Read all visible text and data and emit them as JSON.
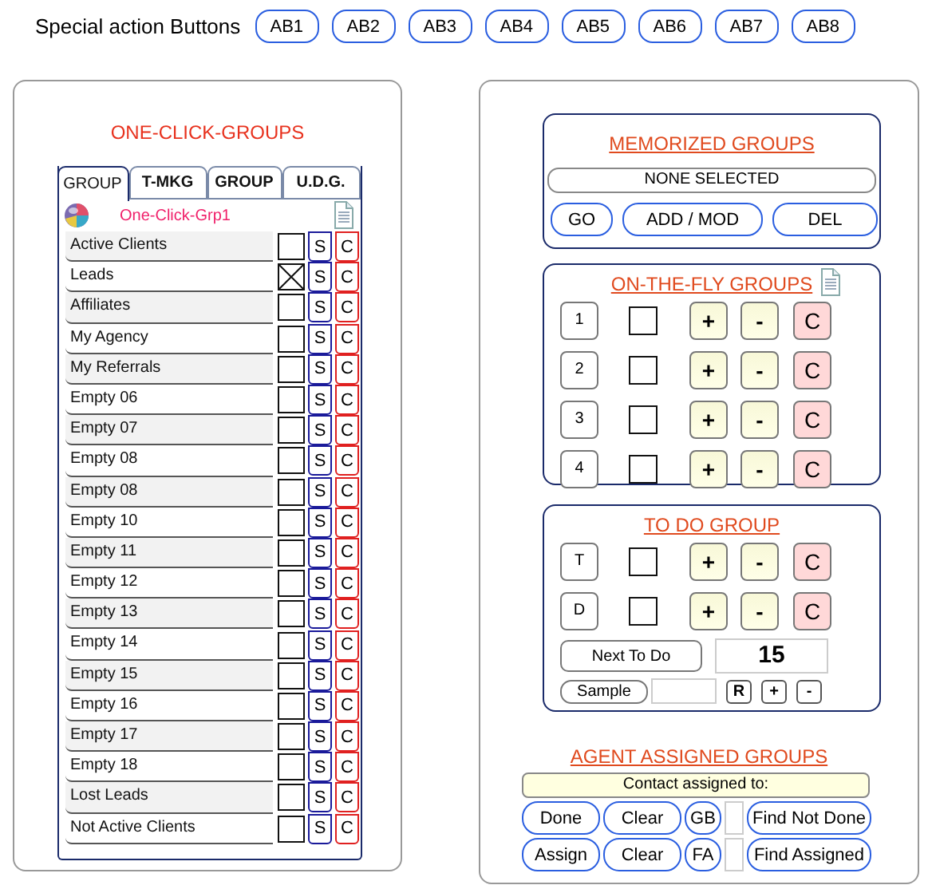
{
  "toolbar": {
    "label": "Special action Buttons",
    "buttons": [
      "AB1",
      "AB2",
      "AB3",
      "AB4",
      "AB5",
      "AB6",
      "AB7",
      "AB8"
    ]
  },
  "one_click_groups": {
    "title": "ONE-CLICK-GROUPS",
    "tabs": [
      {
        "label": "GROUP",
        "selected": true
      },
      {
        "label": "T-MKG",
        "selected": false
      },
      {
        "label": "GROUP",
        "selected": false
      },
      {
        "label": "U.D.G.",
        "selected": false
      }
    ],
    "group_name": "One-Click-Grp1",
    "rows": [
      {
        "name": "Active Clients",
        "checked": false,
        "s": "S",
        "c": "C"
      },
      {
        "name": "Leads",
        "checked": true,
        "s": "S",
        "c": "C"
      },
      {
        "name": "Affiliates",
        "checked": false,
        "s": "S",
        "c": "C"
      },
      {
        "name": "My Agency",
        "checked": false,
        "s": "S",
        "c": "C"
      },
      {
        "name": "My Referrals",
        "checked": false,
        "s": "S",
        "c": "C"
      },
      {
        "name": "Empty 06",
        "checked": false,
        "s": "S",
        "c": "C"
      },
      {
        "name": "Empty 07",
        "checked": false,
        "s": "S",
        "c": "C"
      },
      {
        "name": "Empty 08",
        "checked": false,
        "s": "S",
        "c": "C"
      },
      {
        "name": "Empty 08",
        "checked": false,
        "s": "S",
        "c": "C"
      },
      {
        "name": "Empty 10",
        "checked": false,
        "s": "S",
        "c": "C"
      },
      {
        "name": "Empty 11",
        "checked": false,
        "s": "S",
        "c": "C"
      },
      {
        "name": "Empty 12",
        "checked": false,
        "s": "S",
        "c": "C"
      },
      {
        "name": "Empty 13",
        "checked": false,
        "s": "S",
        "c": "C"
      },
      {
        "name": "Empty 14",
        "checked": false,
        "s": "S",
        "c": "C"
      },
      {
        "name": "Empty 15",
        "checked": false,
        "s": "S",
        "c": "C"
      },
      {
        "name": "Empty 16",
        "checked": false,
        "s": "S",
        "c": "C"
      },
      {
        "name": "Empty 17",
        "checked": false,
        "s": "S",
        "c": "C"
      },
      {
        "name": "Empty 18",
        "checked": false,
        "s": "S",
        "c": "C"
      },
      {
        "name": "Lost Leads",
        "checked": false,
        "s": "S",
        "c": "C"
      },
      {
        "name": "Not Active Clients",
        "checked": false,
        "s": "S",
        "c": "C"
      }
    ]
  },
  "memorized_groups": {
    "title": "MEMORIZED GROUPS",
    "selection": "NONE SELECTED",
    "buttons": [
      "GO",
      "ADD / MOD",
      "DEL"
    ]
  },
  "on_the_fly_groups": {
    "title": "ON-THE-FLY GROUPS",
    "rows": [
      {
        "number": "1",
        "checked": false,
        "plus": "+",
        "minus": "-",
        "clear": "C"
      },
      {
        "number": "2",
        "checked": false,
        "plus": "+",
        "minus": "-",
        "clear": "C"
      },
      {
        "number": "3",
        "checked": false,
        "plus": "+",
        "minus": "-",
        "clear": "C"
      },
      {
        "number": "4",
        "checked": false,
        "plus": "+",
        "minus": "-",
        "clear": "C"
      }
    ]
  },
  "to_do_group": {
    "title": "TO DO GROUP",
    "rows": [
      {
        "number": "T",
        "checked": false,
        "plus": "+",
        "minus": "-",
        "clear": "C"
      },
      {
        "number": "D",
        "checked": false,
        "plus": "+",
        "minus": "-",
        "clear": "C"
      }
    ],
    "next_button": "Next To Do",
    "count": "15",
    "sample_button": "Sample",
    "small_buttons": [
      "R",
      "+",
      "-"
    ]
  },
  "agent_assigned_groups": {
    "title": "AGENT ASSIGNED GROUPS",
    "assigned_label": "Contact assigned to:",
    "rows": [
      {
        "action": "Done",
        "clear": "Clear",
        "code": "GB",
        "find": "Find Not Done"
      },
      {
        "action": "Assign",
        "clear": "Clear",
        "code": "FA",
        "find": "Find Assigned"
      }
    ]
  }
}
